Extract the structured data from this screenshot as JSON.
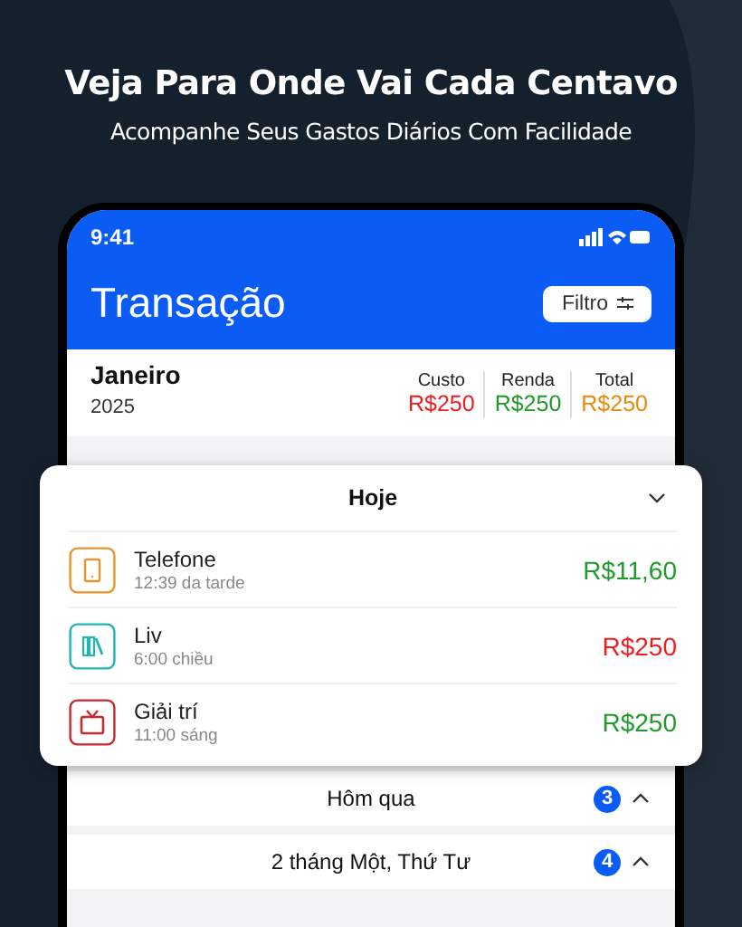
{
  "heading": "Veja Para Onde Vai Cada Centavo",
  "subheading": "Acompanhe Seus Gastos Diários Com Facilidade",
  "phone": {
    "status_bar": {
      "time": "9:41"
    },
    "title": "Transação",
    "filter_button": "Filtro",
    "month": "Janeiro",
    "year": "2025",
    "totals": [
      {
        "label": "Custo",
        "value": "R$250",
        "color": "#f01c1c"
      },
      {
        "label": "Renda",
        "value": "R$250",
        "color": "#1f9a2a"
      },
      {
        "label": "Total",
        "value": "R$250",
        "color": "#e8890c"
      }
    ],
    "today": {
      "title": "Hoje",
      "transactions": [
        {
          "name": "Telefone",
          "time": "12:39 da tarde",
          "amount": "R$11,60",
          "income": true,
          "kind": "phone",
          "color": "#e8962a"
        },
        {
          "name": "Liv",
          "time": "6:00 chiều",
          "amount": "R$250",
          "income": false,
          "kind": "books",
          "color": "#1fb5b0"
        },
        {
          "name": "Giải trí",
          "time": "11:00 sáng",
          "amount": "R$250",
          "income": true,
          "kind": "tv",
          "color": "#c8282e"
        }
      ]
    },
    "groups": [
      {
        "title": "Hôm qua",
        "count": "3"
      },
      {
        "title": "2 tháng Một, Thứ Tư",
        "count": "4"
      }
    ]
  }
}
